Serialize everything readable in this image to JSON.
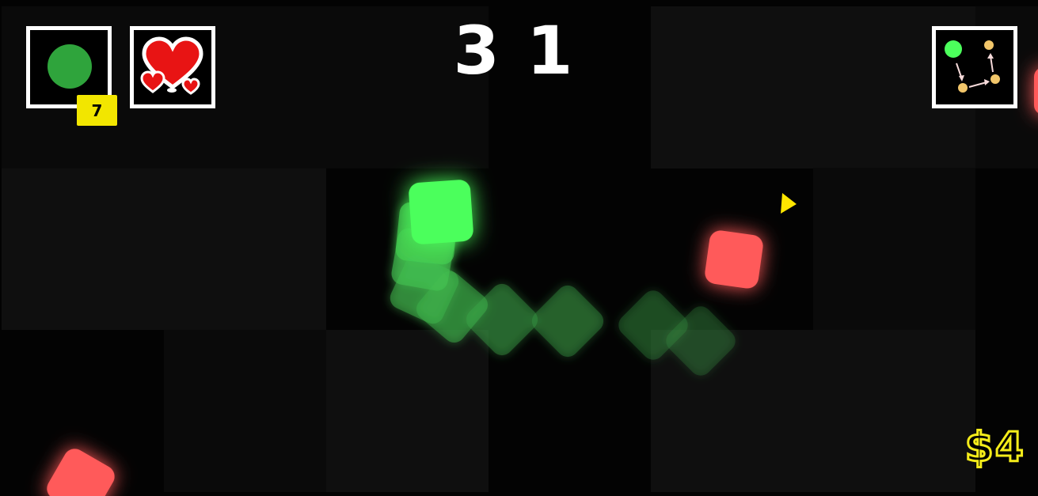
{
  "hud": {
    "score": "31",
    "money": "$4",
    "powerup": {
      "icon": "green-orb-icon",
      "count": "7",
      "count_badge_color": "#f2e600"
    },
    "lives_icon": "hearts-icon",
    "minimap_icon": "route-map-icon"
  },
  "colors": {
    "player": "#4cff5c",
    "enemy": "#ff5a5a",
    "indicator": "#ffe600",
    "money": "#f4ec1a",
    "hud_border": "#ffffff"
  },
  "entities": {
    "player": "green-square-player",
    "enemies": [
      "red-square-enemy",
      "red-square-enemy-bottom-left",
      "red-square-enemy-edge"
    ],
    "direction_indicator": "yellow-arrow-indicator"
  }
}
